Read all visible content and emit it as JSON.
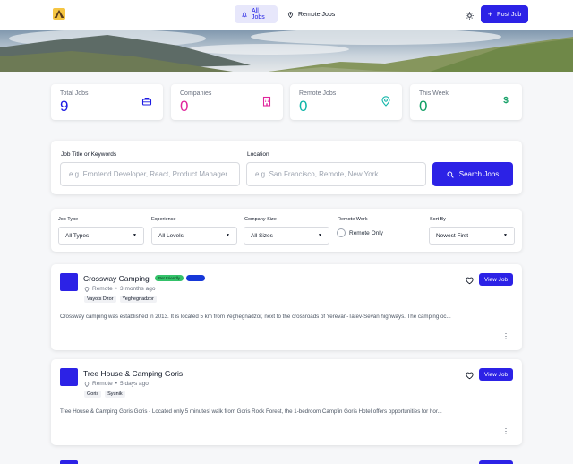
{
  "header": {
    "logo": "camping-tent-logo",
    "nav": [
      {
        "label": "All Jobs",
        "icon": "bell-icon",
        "active": true
      },
      {
        "label": "Remote Jobs",
        "icon": "location-pin-icon",
        "active": false
      }
    ],
    "theme_icon": "sun-icon",
    "post_job_label": "Post Job",
    "post_job_icon": "plus-icon"
  },
  "stats": [
    {
      "label": "Total Jobs",
      "value": "9",
      "color": "#1d1be3",
      "icon": "briefcase-icon"
    },
    {
      "label": "Companies",
      "value": "0",
      "color": "#e0249c",
      "icon": "building-icon"
    },
    {
      "label": "Remote Jobs",
      "value": "0",
      "color": "#0fb5a8",
      "icon": "location-pin-icon"
    },
    {
      "label": "This Week",
      "value": "0",
      "color": "#0f9e63",
      "icon": "dollar-icon"
    }
  ],
  "search": {
    "keywords_label": "Job Title or Keywords",
    "keywords_placeholder": "e.g. Frontend Developer, React, Product Manager",
    "location_label": "Location",
    "location_placeholder": "e.g. San Francisco, Remote, New York...",
    "button_label": "Search Jobs"
  },
  "filters": {
    "job_type": {
      "label": "Job Type",
      "value": "All Types"
    },
    "experience": {
      "label": "Experience",
      "value": "All Levels"
    },
    "company_size": {
      "label": "Company Size",
      "value": "All Sizes"
    },
    "remote_work": {
      "label": "Remote Work",
      "option": "Remote Only"
    },
    "sort_by": {
      "label": "Sort By",
      "value": "Newest First"
    }
  },
  "jobs": [
    {
      "title": "Crossway Camping",
      "badge": "Pet Friendly",
      "location": "Remote",
      "posted": "3 months ago",
      "tags": [
        "Vayots Dzor",
        "Yeghegnadzor"
      ],
      "description": "Crossway camping was established in 2013. It is located 5 km from Yeghegnadzor, next to the crossroads of Yerevan-Tatev-Sevan highways. The camping oc...",
      "view_label": "View Job"
    },
    {
      "title": "Tree House & Camping Goris",
      "location": "Remote",
      "posted": "5 days ago",
      "tags": [
        "Goris",
        "Syunik"
      ],
      "description": "Tree House & Camping Goris Goris - Located only 5 minutes' walk from Goris Rock Forest, the 1-bedroom Camp'in Goris Hotel offers opportunities for hor...",
      "view_label": "View Job"
    }
  ],
  "colors": {
    "accent": "#2c22e6"
  }
}
